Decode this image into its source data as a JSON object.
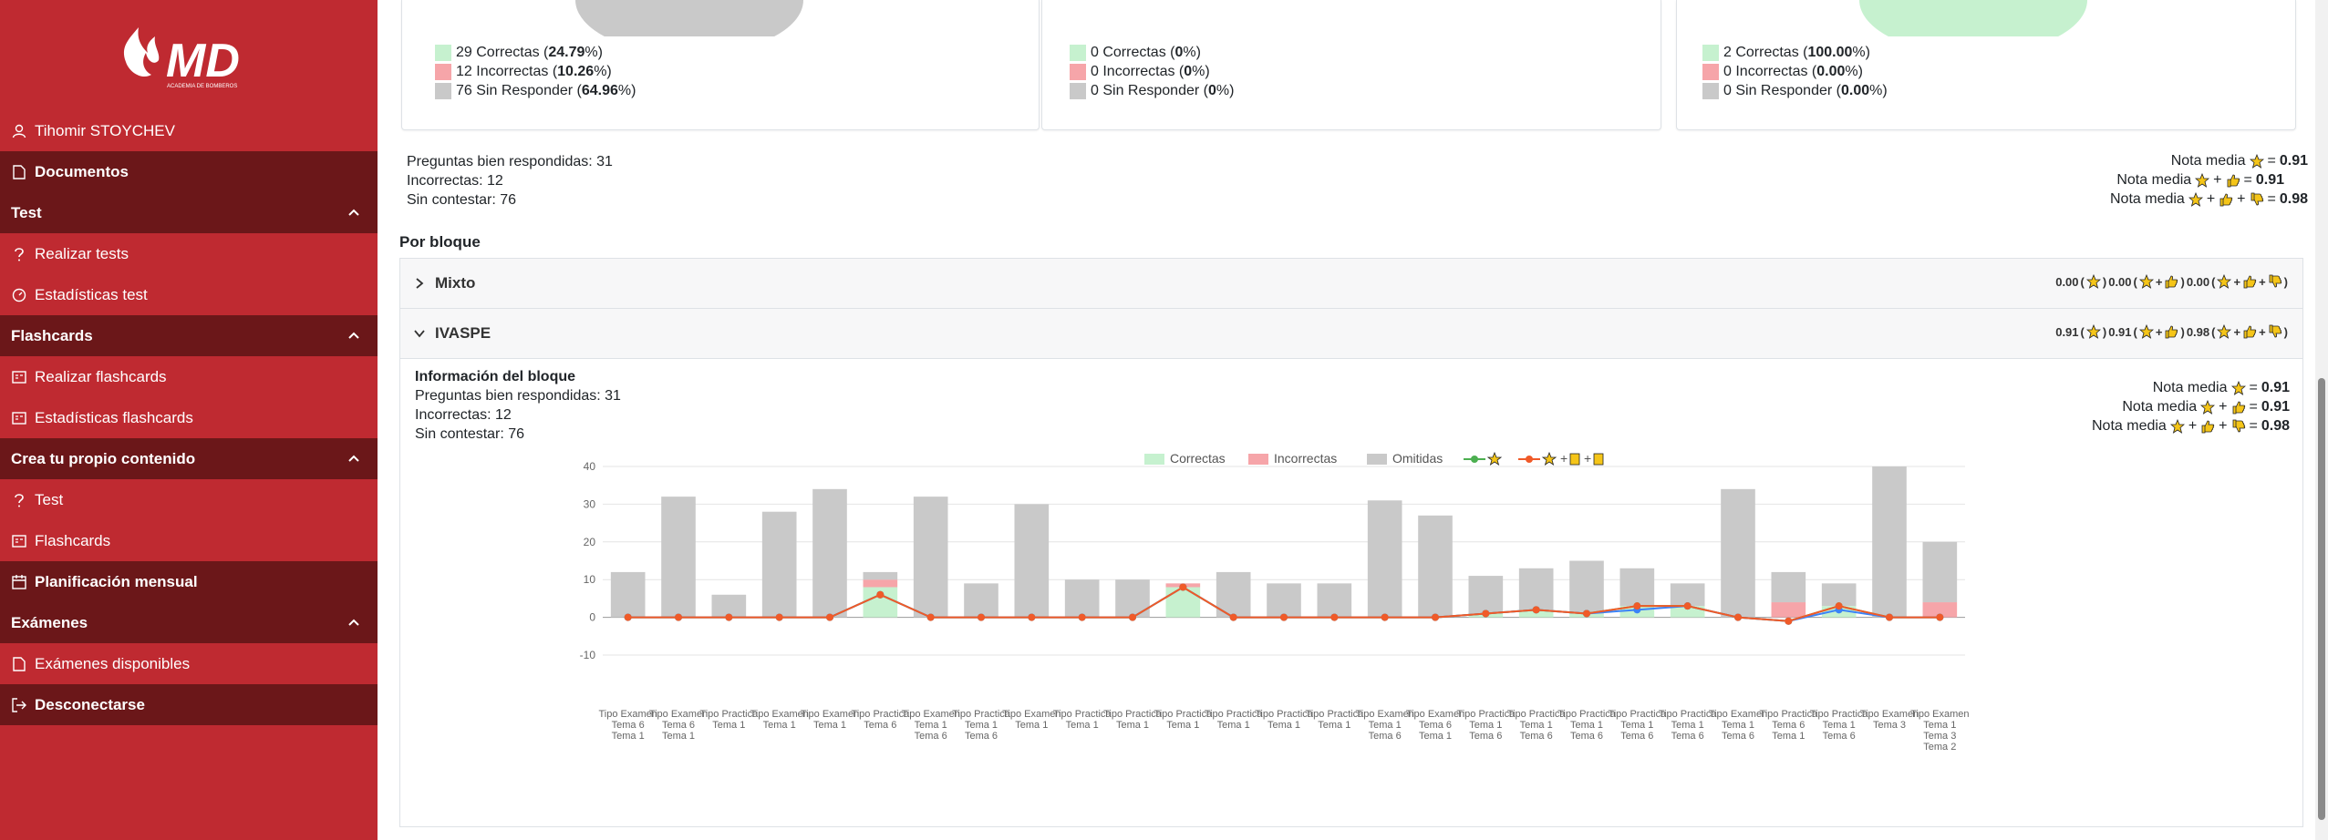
{
  "user": {
    "name": "Tihomir STOYCHEV"
  },
  "logo": {
    "text": "MD",
    "subtitle": "ACADEMIA DE BOMBEROS"
  },
  "sidebar": {
    "documentos": "Documentos",
    "test_header": "Test",
    "realizar_tests": "Realizar tests",
    "estadisticas_test": "Estadísticas test",
    "flashcards_header": "Flashcards",
    "realizar_flashcards": "Realizar flashcards",
    "estadisticas_flashcards": "Estadísticas flashcards",
    "crea_header": "Crea tu propio contenido",
    "crea_test": "Test",
    "crea_flashcards": "Flashcards",
    "planificacion": "Planificación mensual",
    "examenes_header": "Exámenes",
    "examenes_disponibles": "Exámenes disponibles",
    "desconectarse": "Desconectarse"
  },
  "cards": [
    {
      "correctas": "29 Correctas (",
      "correctas_pct": "24.79",
      "incorrectas": "12 Incorrectas (",
      "incorrectas_pct": "10.26",
      "sin": "76 Sin Responder (",
      "sin_pct": "64.96"
    },
    {
      "correctas": "0 Correctas (",
      "correctas_pct": "0",
      "incorrectas": "0 Incorrectas (",
      "incorrectas_pct": "0",
      "sin": "0 Sin Responder (",
      "sin_pct": "0"
    },
    {
      "correctas": "2 Correctas (",
      "correctas_pct": "100.00",
      "incorrectas": "0 Incorrectas (",
      "incorrectas_pct": "0.00",
      "sin": "0 Sin Responder (",
      "sin_pct": "0.00"
    }
  ],
  "summary": {
    "bien": "Preguntas bien respondidas: 31",
    "incorrectas": "Incorrectas: 12",
    "sin": "Sin contestar: 76",
    "nota_label": "Nota media",
    "nota1": "0.91",
    "nota2": "0.91",
    "nota3": "0.98"
  },
  "por_bloque": "Por bloque",
  "blocks": [
    {
      "name": "Mixto",
      "s1": "0.00",
      "s2": "0.00",
      "s3": "0.00"
    },
    {
      "name": "IVASPE",
      "s1": "0.91",
      "s2": "0.91",
      "s3": "0.98"
    }
  ],
  "block_info": {
    "title": "Información del bloque",
    "bien": "Preguntas bien respondidas: 31",
    "incorrectas": "Incorrectas: 12",
    "sin": "Sin contestar: 76",
    "nota1": "0.91",
    "nota2": "0.91",
    "nota3": "0.98"
  },
  "colors": {
    "sidebar": "#bf2a31",
    "sidebar_dark": "#6b1719",
    "correct": "#c6f1cf",
    "incorrect": "#f6a5a9",
    "omitted": "#c9c9c9",
    "line_green": "#4caf50",
    "line_orange": "#f05a28",
    "line_blue": "#3b82f6"
  },
  "chart_data": {
    "type": "bar",
    "legend": [
      "Correctas",
      "Incorrectas",
      "Omitidas"
    ],
    "ylim": [
      -10,
      40
    ],
    "yticks": [
      40,
      30,
      20,
      10,
      0,
      -10
    ],
    "categories": [
      [
        "Tipo Examen",
        "Tema 6",
        "Tema 1"
      ],
      [
        "Tipo Examen",
        "Tema 6",
        "Tema 1"
      ],
      [
        "Tipo Practica",
        "Tema 1"
      ],
      [
        "Tipo Examen",
        "Tema 1"
      ],
      [
        "Tipo Examen",
        "Tema 1"
      ],
      [
        "Tipo Practica",
        "Tema 6"
      ],
      [
        "Tipo Examen",
        "Tema 1",
        "Tema 6"
      ],
      [
        "Tipo Practica",
        "Tema 1",
        "Tema 6"
      ],
      [
        "Tipo Examen",
        "Tema 1"
      ],
      [
        "Tipo Practica",
        "Tema 1"
      ],
      [
        "Tipo Practica",
        "Tema 1"
      ],
      [
        "Tipo Practica",
        "Tema 1"
      ],
      [
        "Tipo Practica",
        "Tema 1"
      ],
      [
        "Tipo Practica",
        "Tema 1"
      ],
      [
        "Tipo Practica",
        "Tema 1"
      ],
      [
        "Tipo Examen",
        "Tema 1",
        "Tema 6"
      ],
      [
        "Tipo Examen",
        "Tema 6",
        "Tema 1"
      ],
      [
        "Tipo Practica",
        "Tema 1",
        "Tema 6"
      ],
      [
        "Tipo Practica",
        "Tema 1",
        "Tema 6"
      ],
      [
        "Tipo Practica",
        "Tema 1",
        "Tema 6"
      ],
      [
        "Tipo Practica",
        "Tema 1",
        "Tema 6"
      ],
      [
        "Tipo Practica",
        "Tema 1",
        "Tema 6"
      ],
      [
        "Tipo Examen",
        "Tema 1",
        "Tema 6"
      ],
      [
        "Tipo Practica",
        "Tema 6",
        "Tema 1"
      ],
      [
        "Tipo Practica",
        "Tema 1",
        "Tema 6"
      ],
      [
        "Tipo Examen",
        "Tema 3"
      ],
      [
        "Tipo Examen",
        "Tema 1",
        "Tema 3",
        "Tema 2"
      ]
    ],
    "series": [
      {
        "name": "Correctas",
        "values": [
          0,
          0,
          0,
          0,
          0,
          8,
          0,
          0,
          0,
          0,
          0,
          8,
          0,
          0,
          0,
          0,
          0,
          1,
          2,
          1,
          3,
          3,
          0,
          0,
          3,
          0,
          0
        ]
      },
      {
        "name": "Incorrectas",
        "values": [
          0,
          0,
          0,
          0,
          0,
          2,
          0,
          0,
          0,
          0,
          0,
          1,
          0,
          0,
          0,
          0,
          0,
          0,
          0,
          0,
          0,
          0,
          0,
          4,
          0,
          0,
          4
        ]
      },
      {
        "name": "Omitidas",
        "values": [
          12,
          32,
          6,
          28,
          34,
          2,
          32,
          9,
          30,
          10,
          10,
          0,
          12,
          9,
          9,
          31,
          27,
          10,
          11,
          14,
          10,
          6,
          34,
          8,
          6,
          40,
          16
        ]
      }
    ],
    "lines": [
      {
        "color": "#4caf50",
        "values": [
          0,
          0,
          0,
          0,
          0,
          6,
          0,
          0,
          0,
          0,
          0,
          8,
          0,
          0,
          0,
          0,
          0,
          1,
          2,
          1,
          3,
          3,
          0,
          -1,
          3,
          0,
          0
        ]
      },
      {
        "color": "#3b82f6",
        "values": [
          0,
          0,
          0,
          0,
          0,
          6,
          0,
          0,
          0,
          0,
          0,
          8,
          0,
          0,
          0,
          0,
          0,
          1,
          2,
          1,
          2,
          3,
          0,
          -1,
          2,
          0,
          0
        ]
      },
      {
        "color": "#f05a28",
        "values": [
          0,
          0,
          0,
          0,
          0,
          6,
          0,
          0,
          0,
          0,
          0,
          8,
          0,
          0,
          0,
          0,
          0,
          1,
          2,
          1,
          3,
          3,
          0,
          -1,
          3,
          0,
          0
        ]
      }
    ]
  }
}
